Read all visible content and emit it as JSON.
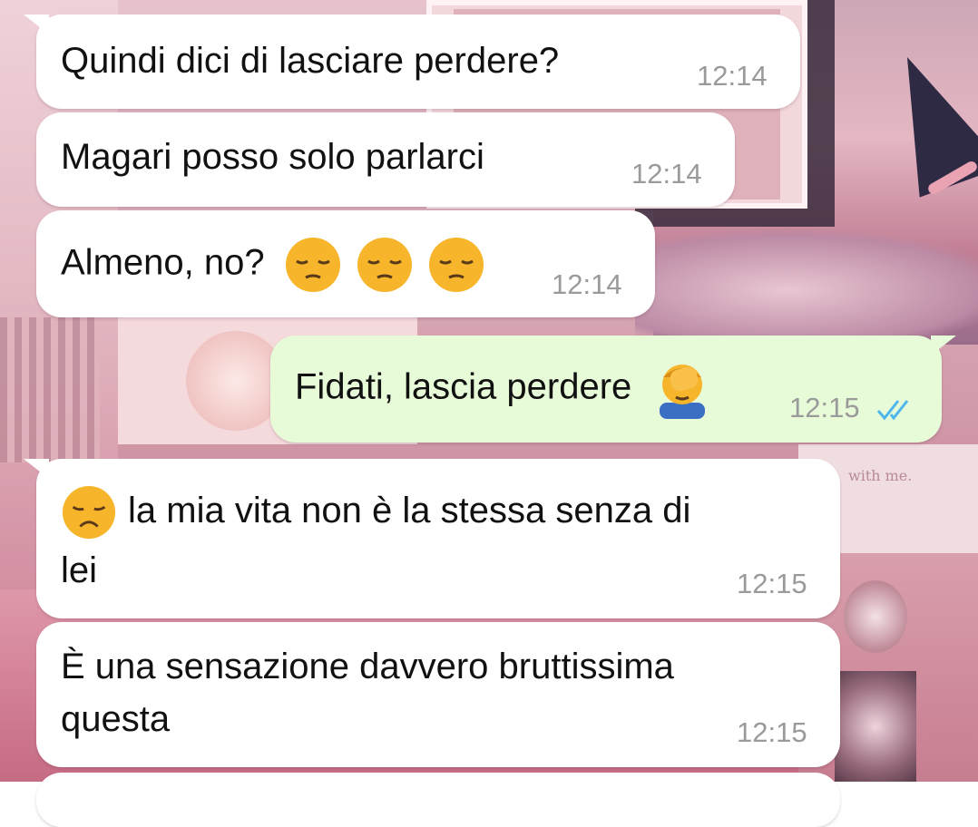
{
  "messages": [
    {
      "direction": "in",
      "text": "Quindi dici di lasciare perdere?",
      "time": "12:14"
    },
    {
      "direction": "in",
      "text": "Magari posso solo parlarci",
      "time": "12:14"
    },
    {
      "direction": "in",
      "text": "Almeno, no?",
      "emoji": [
        "pensive-face",
        "pensive-face",
        "pensive-face"
      ],
      "time": "12:14"
    },
    {
      "direction": "out",
      "text": "Fidati, lascia perdere",
      "emoji": [
        "man-facepalming"
      ],
      "time": "12:15",
      "status": "read"
    },
    {
      "direction": "in",
      "lead_emoji": "disappointed-face",
      "text_line1": "la mia vita non è la stessa senza di",
      "text_line2": "lei",
      "time": "12:15"
    },
    {
      "direction": "in",
      "text_line1": "È una sensazione davvero bruttissima",
      "text_line2": "questa",
      "time": "12:15"
    }
  ],
  "wallpaper": {
    "caption": "with me."
  },
  "colors": {
    "incoming_bubble": "#ffffff",
    "outgoing_bubble": "#e7fbd8",
    "read_ticks": "#4fb6ec",
    "timestamp": "#9a9a9a"
  }
}
